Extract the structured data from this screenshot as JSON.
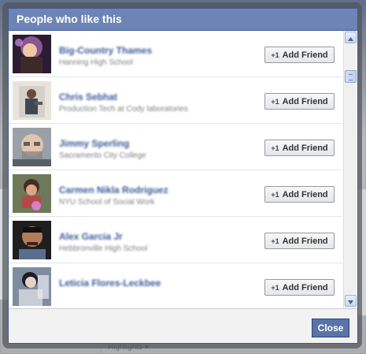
{
  "dialog": {
    "title": "People who like this",
    "close_label": "Close"
  },
  "background": {
    "highlights_label": "Highlights ▾"
  },
  "people": [
    {
      "name": "Big-Country Thames",
      "subtitle": "Hanning High School",
      "button_label": "Add Friend",
      "button_icon": "+1"
    },
    {
      "name": "Chris Sebhat",
      "subtitle": "Production Tech at Cody laboratories",
      "button_label": "Add Friend",
      "button_icon": "+1"
    },
    {
      "name": "Jimmy Sperling",
      "subtitle": "Sacramento City College",
      "button_label": "Add Friend",
      "button_icon": "+1"
    },
    {
      "name": "Carmen Nikla Rodriguez",
      "subtitle": "NYU School of Social Work",
      "button_label": "Add Friend",
      "button_icon": "+1"
    },
    {
      "name": "Alex Garcia Jr",
      "subtitle": "Hebbronville High School",
      "button_label": "Add Friend",
      "button_icon": "+1"
    },
    {
      "name": "Leticia Flores-Leckbee",
      "subtitle": "",
      "button_label": "Add Friend",
      "button_icon": "+1"
    }
  ],
  "colors": {
    "header_bg": "#6d84b4",
    "name_link": "#3b5998",
    "close_button": "#5b74a8"
  },
  "icons": {
    "scroll_up": "arrow-up-icon",
    "scroll_down": "arrow-down-icon",
    "add_friend": "plus-one-icon"
  }
}
